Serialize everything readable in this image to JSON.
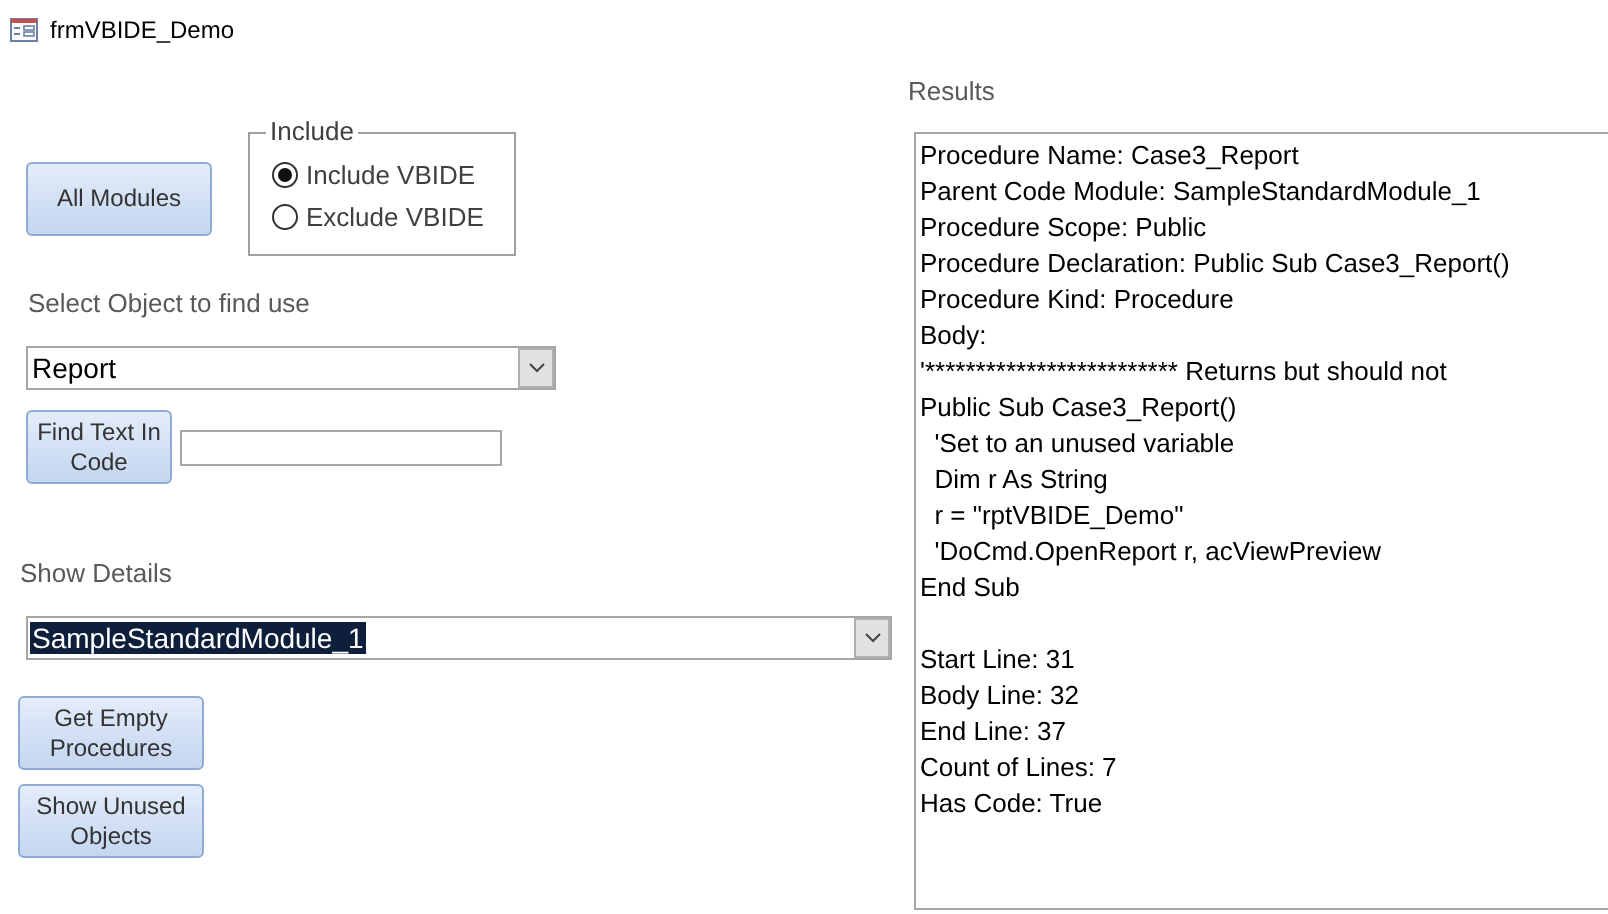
{
  "window": {
    "title": "frmVBIDE_Demo"
  },
  "all_modules_button": "All Modules",
  "include_group": {
    "legend": "Include",
    "options": [
      {
        "label": "Include VBIDE",
        "selected": true
      },
      {
        "label": "Exclude VBIDE",
        "selected": false
      }
    ]
  },
  "select_object": {
    "label": "Select Object to find use",
    "value": "Report"
  },
  "find_text_button": "Find Text In Code",
  "show_details": {
    "label": "Show Details",
    "value": "SampleStandardModule_1",
    "highlighted": true
  },
  "buttons": [
    "Get Empty Procedures",
    "Show Unused Objects"
  ],
  "results": {
    "label": "Results",
    "lines": [
      "Procedure Name: Case3_Report",
      "Parent Code Module: SampleStandardModule_1",
      "Procedure Scope: Public",
      "Procedure Declaration: Public Sub Case3_Report()",
      "Procedure Kind: Procedure",
      "Body:",
      "'************************* Returns but should not",
      "Public Sub Case3_Report()",
      "  'Set to an unused variable",
      "  Dim r As String",
      "  r = \"rptVBIDE_Demo\"",
      "  'DoCmd.OpenReport r, acViewPreview",
      "End Sub"
    ],
    "summary_lines": [
      "Start Line: 31",
      "Body Line: 32",
      "End Line: 37",
      "Count of Lines: 7",
      "Has Code: True"
    ]
  }
}
